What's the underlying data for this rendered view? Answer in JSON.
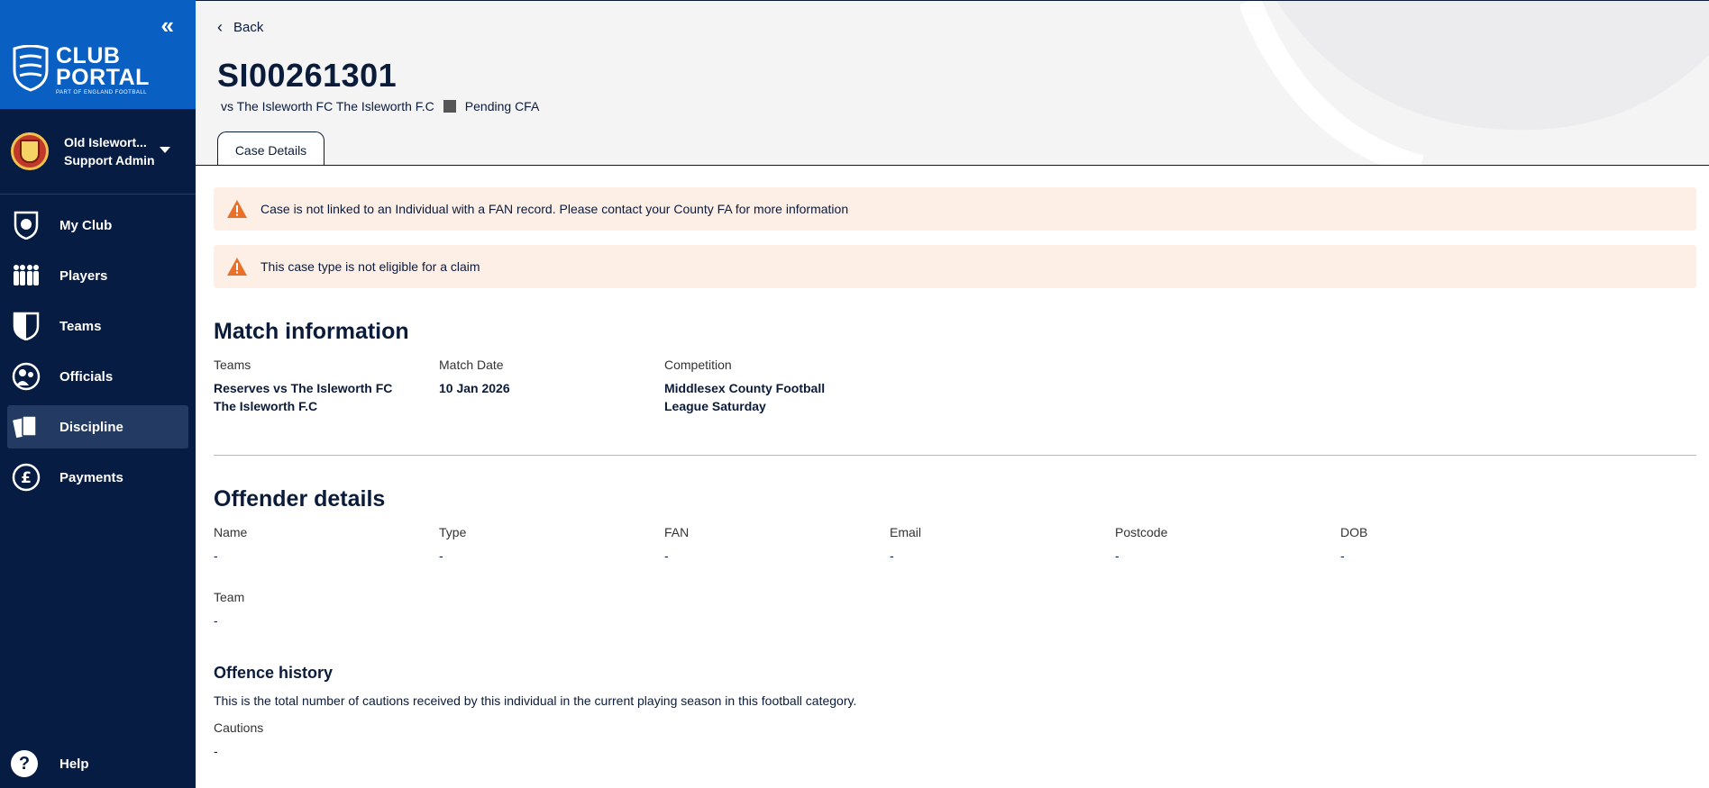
{
  "sidebar": {
    "collapse_glyph": "«",
    "logo": {
      "line1": "CLUB",
      "line2": "PORTAL",
      "line3": "PART OF ENGLAND FOOTBALL"
    },
    "account": {
      "club": "Old Islewort...",
      "role": "Support Admin"
    },
    "nav": [
      {
        "label": "My Club",
        "icon": "club-shield-icon",
        "active": false
      },
      {
        "label": "Players",
        "icon": "players-icon",
        "active": false
      },
      {
        "label": "Teams",
        "icon": "teams-icon",
        "active": false
      },
      {
        "label": "Officials",
        "icon": "officials-icon",
        "active": false
      },
      {
        "label": "Discipline",
        "icon": "cards-icon",
        "active": true
      },
      {
        "label": "Payments",
        "icon": "pound-icon",
        "active": false
      }
    ],
    "help": {
      "label": "Help",
      "glyph": "?"
    }
  },
  "header": {
    "back_label": "Back",
    "case_id": "SI00261301",
    "fixture": "vs The Isleworth FC The Isleworth F.C",
    "status": "Pending CFA",
    "tab": "Case Details"
  },
  "alerts": [
    {
      "text": "Case is not linked to an Individual with a FAN record. Please contact your County FA for more information"
    },
    {
      "text": "This case type is not eligible for a claim"
    }
  ],
  "match": {
    "title": "Match information",
    "fields": [
      {
        "label": "Teams",
        "value": "Reserves vs The Isleworth FC The Isleworth F.C"
      },
      {
        "label": "Match Date",
        "value": "10 Jan 2026"
      },
      {
        "label": "Competition",
        "value": "Middlesex County Football League Saturday"
      }
    ]
  },
  "offender": {
    "title": "Offender details",
    "fields": [
      {
        "label": "Name",
        "value": "-"
      },
      {
        "label": "Type",
        "value": "-"
      },
      {
        "label": "FAN",
        "value": "-"
      },
      {
        "label": "Email",
        "value": "-"
      },
      {
        "label": "Postcode",
        "value": "-"
      },
      {
        "label": "DOB",
        "value": "-"
      }
    ],
    "team": {
      "label": "Team",
      "value": "-"
    }
  },
  "history": {
    "title": "Offence history",
    "description": "This is the total number of cautions received by this individual in the current playing season in this football category.",
    "cautions": {
      "label": "Cautions",
      "value": "-"
    }
  },
  "colors": {
    "sidebar": "#071c43",
    "brand": "#0a5fc2",
    "alert_bg": "#fdeee6",
    "warn": "#e8702a"
  }
}
